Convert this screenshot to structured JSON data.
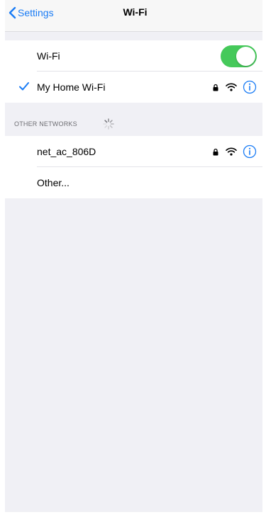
{
  "nav": {
    "back_label": "Settings",
    "title": "Wi-Fi"
  },
  "wifi_toggle": {
    "label": "Wi-Fi",
    "on": true,
    "color": "#45c95a"
  },
  "connected_network": {
    "name": "My Home Wi-Fi",
    "secured": true,
    "icons": [
      "checkmark-icon",
      "lock-icon",
      "wifi-signal-icon",
      "info-icon"
    ]
  },
  "other_networks": {
    "header": "OTHER NETWORKS",
    "loading_icon": "spinner-icon",
    "items": [
      {
        "name": "net_ac_806D",
        "secured": true
      },
      {
        "name": "Other..."
      }
    ]
  },
  "colors": {
    "accent": "#1a7cf5",
    "toggle_on": "#45c95a",
    "background": "#f0f0f5"
  }
}
